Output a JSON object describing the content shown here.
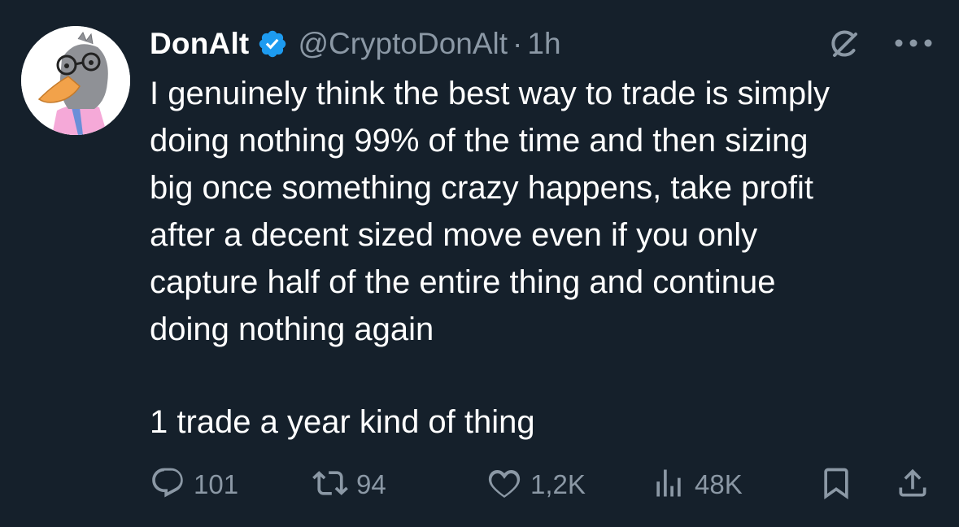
{
  "tweet": {
    "author": {
      "display_name": "DonAlt",
      "handle": "@CryptoDonAlt",
      "verified": true,
      "avatar": "duck-with-glasses-avatar"
    },
    "separator": "·",
    "time": "1h",
    "text": "I genuinely think the best way to trade is simply\ndoing nothing 99% of the time and then sizing\nbig once something crazy happens, take profit\nafter a decent sized move even if you only\ncapture half of the entire thing and continue\ndoing nothing again",
    "text_last": "1 trade a year kind of thing",
    "actions": {
      "replies": "101",
      "reposts": "94",
      "likes": "1,2K",
      "views": "48K"
    }
  },
  "colors": {
    "background": "#15202b",
    "text": "#ffffff",
    "muted": "#8b98a5",
    "verified": "#1d9bf0"
  },
  "icons": [
    "verified-badge-icon",
    "grok-icon",
    "more-icon",
    "reply-icon",
    "repost-icon",
    "like-icon",
    "views-icon",
    "bookmark-icon",
    "share-icon"
  ]
}
